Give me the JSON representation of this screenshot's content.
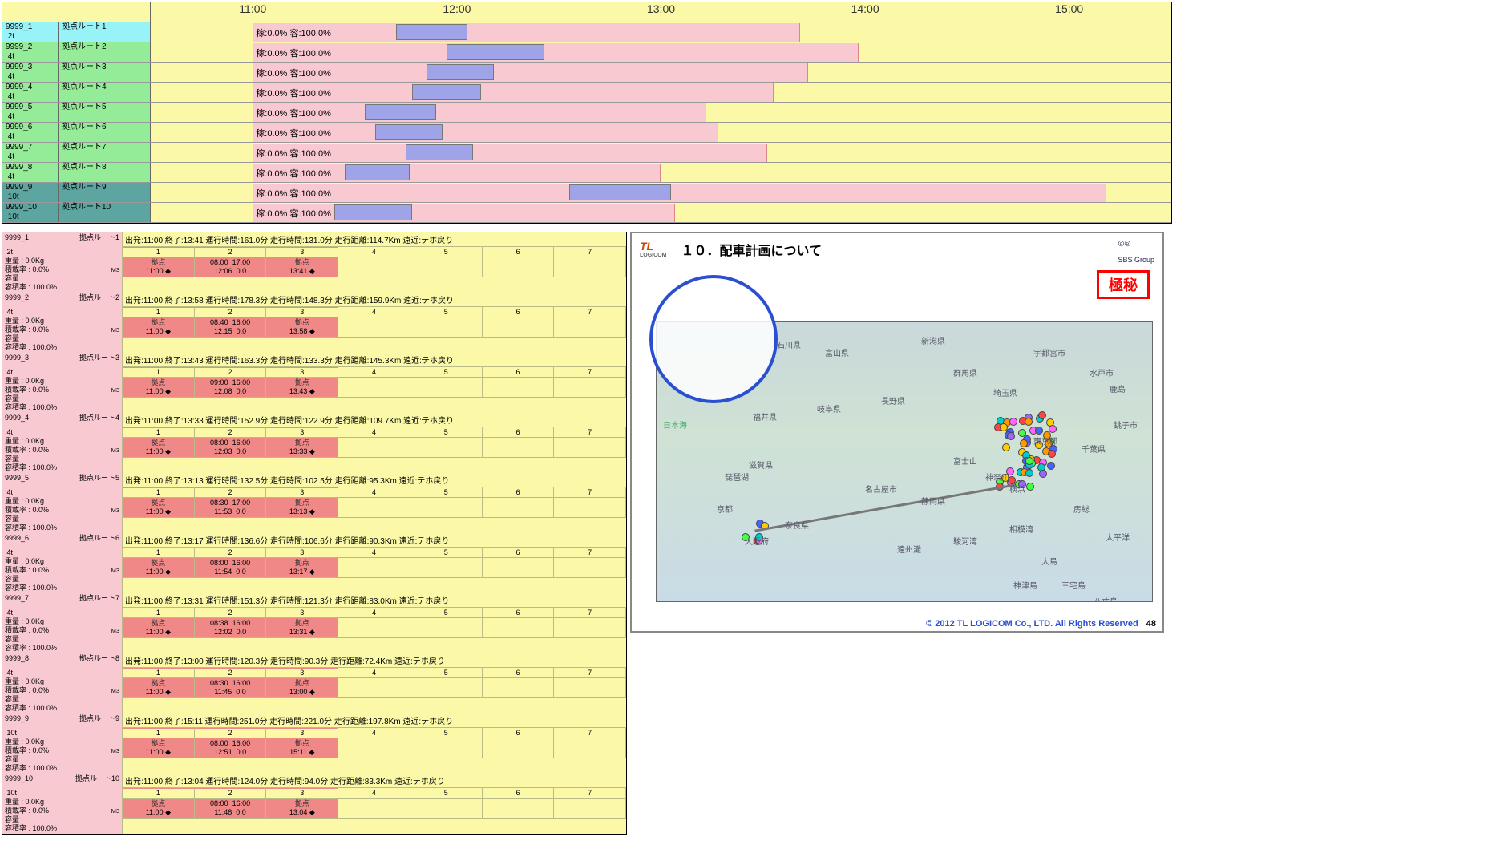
{
  "gantt": {
    "time_start": 10.5,
    "time_end": 15.5,
    "ticks": [
      "11:00",
      "12:00",
      "13:00",
      "14:00",
      "15:00"
    ],
    "label_text": "稼:0.0% 容:100.0%",
    "rows": [
      {
        "id": "9999_1",
        "cap": "2t",
        "route": "拠点ルート1",
        "cls": "lc-cyan",
        "pink_s": 11.0,
        "pink_e": 13.68,
        "blue_s": 11.7,
        "blue_e": 12.05
      },
      {
        "id": "9999_2",
        "cap": "4t",
        "route": "拠点ルート2",
        "cls": "lc-green",
        "pink_s": 11.0,
        "pink_e": 13.97,
        "blue_s": 11.95,
        "blue_e": 12.43
      },
      {
        "id": "9999_3",
        "cap": "4t",
        "route": "拠点ルート3",
        "cls": "lc-green",
        "pink_s": 11.0,
        "pink_e": 13.72,
        "blue_s": 11.85,
        "blue_e": 12.18
      },
      {
        "id": "9999_4",
        "cap": "4t",
        "route": "拠点ルート4",
        "cls": "lc-green",
        "pink_s": 11.0,
        "pink_e": 13.55,
        "blue_s": 11.78,
        "blue_e": 12.12
      },
      {
        "id": "9999_5",
        "cap": "4t",
        "route": "拠点ルート5",
        "cls": "lc-green",
        "pink_s": 11.0,
        "pink_e": 13.22,
        "blue_s": 11.55,
        "blue_e": 11.9
      },
      {
        "id": "9999_6",
        "cap": "4t",
        "route": "拠点ルート6",
        "cls": "lc-green",
        "pink_s": 11.0,
        "pink_e": 13.28,
        "blue_s": 11.6,
        "blue_e": 11.93
      },
      {
        "id": "9999_7",
        "cap": "4t",
        "route": "拠点ルート7",
        "cls": "lc-green",
        "pink_s": 11.0,
        "pink_e": 13.52,
        "blue_s": 11.75,
        "blue_e": 12.08
      },
      {
        "id": "9999_8",
        "cap": "4t",
        "route": "拠点ルート8",
        "cls": "lc-green",
        "pink_s": 11.0,
        "pink_e": 13.0,
        "blue_s": 11.45,
        "blue_e": 11.77
      },
      {
        "id": "9999_9",
        "cap": "10t",
        "route": "拠点ルート9",
        "cls": "lc-teal",
        "pink_s": 11.0,
        "pink_e": 15.18,
        "blue_s": 12.55,
        "blue_e": 13.05
      },
      {
        "id": "9999_10",
        "cap": "10t",
        "route": "拠点ルート10",
        "cls": "lc-teal",
        "pink_s": 11.0,
        "pink_e": 13.07,
        "blue_s": 11.4,
        "blue_e": 11.78
      }
    ]
  },
  "detail": {
    "stat_labels": {
      "weight": "重量 :",
      "loadrate": "積載率 :",
      "vol": "容量",
      "volrate": "容積率 :"
    },
    "stat_vals": {
      "weight": "0.0Kg",
      "loadrate": "0.0%",
      "vol": "M3",
      "volrate": "100.0%"
    },
    "col_count": 7,
    "kyoten": "拠点",
    "routes": [
      {
        "id": "9999_1",
        "cap": "2t",
        "route": "拠点ルート1",
        "summary": "出発:11:00 終了:13:41  運行時間:161.0分  走行時間:131.0分  走行距離:114.7Km  遠近:テホ戻り",
        "cells": [
          {
            "t1": "11:00 ◆"
          },
          {
            "t1": "08:00",
            "t2": "12:06",
            "t3": "17:00",
            "t4": "0.0"
          },
          {
            "t1": "13:41 ◆"
          }
        ]
      },
      {
        "id": "9999_2",
        "cap": "4t",
        "route": "拠点ルート2",
        "summary": "出発:11:00 終了:13:58  運行時間:178.3分  走行時間:148.3分  走行距離:159.9Km  遠近:テホ戻り",
        "cells": [
          {
            "t1": "11:00 ◆"
          },
          {
            "t1": "08:40",
            "t2": "12:15",
            "t3": "16:00",
            "t4": "0.0"
          },
          {
            "t1": "13:58 ◆"
          }
        ]
      },
      {
        "id": "9999_3",
        "cap": "4t",
        "route": "拠点ルート3",
        "summary": "出発:11:00 終了:13:43  運行時間:163.3分  走行時間:133.3分  走行距離:145.3Km  遠近:テホ戻り",
        "cells": [
          {
            "t1": "11:00 ◆"
          },
          {
            "t1": "09:00",
            "t2": "12:08",
            "t3": "16:00",
            "t4": "0.0"
          },
          {
            "t1": "13:43 ◆"
          }
        ]
      },
      {
        "id": "9999_4",
        "cap": "4t",
        "route": "拠点ルート4",
        "summary": "出発:11:00 終了:13:33  運行時間:152.9分  走行時間:122.9分  走行距離:109.7Km  遠近:テホ戻り",
        "cells": [
          {
            "t1": "11:00 ◆"
          },
          {
            "t1": "08:00",
            "t2": "12:03",
            "t3": "16:00",
            "t4": "0.0"
          },
          {
            "t1": "13:33 ◆"
          }
        ]
      },
      {
        "id": "9999_5",
        "cap": "4t",
        "route": "拠点ルート5",
        "summary": "出発:11:00 終了:13:13  運行時間:132.5分  走行時間:102.5分  走行距離:95.3Km  遠近:テホ戻り",
        "cells": [
          {
            "t1": "11:00 ◆"
          },
          {
            "t1": "08:30",
            "t2": "11:53",
            "t3": "17:00",
            "t4": "0.0"
          },
          {
            "t1": "13:13 ◆"
          }
        ]
      },
      {
        "id": "9999_6",
        "cap": "4t",
        "route": "拠点ルート6",
        "summary": "出発:11:00 終了:13:17  運行時間:136.6分  走行時間:106.6分  走行距離:90.3Km  遠近:テホ戻り",
        "cells": [
          {
            "t1": "11:00 ◆"
          },
          {
            "t1": "08:00",
            "t2": "11:54",
            "t3": "16:00",
            "t4": "0.0"
          },
          {
            "t1": "13:17 ◆"
          }
        ]
      },
      {
        "id": "9999_7",
        "cap": "4t",
        "route": "拠点ルート7",
        "summary": "出発:11:00 終了:13:31  運行時間:151.3分  走行時間:121.3分  走行距離:83.0Km  遠近:テホ戻り",
        "cells": [
          {
            "t1": "11:00 ◆"
          },
          {
            "t1": "08:38",
            "t2": "12:02",
            "t3": "16:00",
            "t4": "0.0"
          },
          {
            "t1": "13:31 ◆"
          }
        ]
      },
      {
        "id": "9999_8",
        "cap": "4t",
        "route": "拠点ルート8",
        "summary": "出発:11:00 終了:13:00  運行時間:120.3分  走行時間:90.3分  走行距離:72.4Km  遠近:テホ戻り",
        "cells": [
          {
            "t1": "11:00 ◆"
          },
          {
            "t1": "08:30",
            "t2": "11:45",
            "t3": "16:00",
            "t4": "0.0"
          },
          {
            "t1": "13:00 ◆"
          }
        ]
      },
      {
        "id": "9999_9",
        "cap": "10t",
        "route": "拠点ルート9",
        "summary": "出発:11:00 終了:15:11  運行時間:251.0分  走行時間:221.0分  走行距離:197.8Km  遠近:テホ戻り",
        "cells": [
          {
            "t1": "11:00 ◆"
          },
          {
            "t1": "08:00",
            "t2": "12:51",
            "t3": "16:00",
            "t4": "0.0"
          },
          {
            "t1": "15:11 ◆"
          }
        ]
      },
      {
        "id": "9999_10",
        "cap": "10t",
        "route": "拠点ルート10",
        "summary": "出発:11:00 終了:13:04  運行時間:124.0分  走行時間:94.0分  走行距離:83.3Km  遠近:テホ戻り",
        "cells": [
          {
            "t1": "11:00 ◆"
          },
          {
            "t1": "08:00",
            "t2": "11:48",
            "t3": "16:00",
            "t4": "0.0"
          },
          {
            "t1": "13:04 ◆"
          }
        ]
      }
    ]
  },
  "slide": {
    "logo_main": "TL",
    "logo_sub": "LOGICOM",
    "title": "１０．配車計画について",
    "badge": "極秘",
    "sea_label": "日本海",
    "places": [
      "石川県",
      "富山県",
      "岐阜県",
      "長野県",
      "新潟県",
      "群馬県",
      "埼玉県",
      "宇都宮市",
      "水戸市",
      "東京都",
      "千葉県",
      "福井県",
      "滋賀県",
      "琵琶湖",
      "京都",
      "大阪府",
      "奈良県",
      "名古屋市",
      "静岡県",
      "富士山",
      "横浜",
      "神奈川",
      "遠州灘",
      "駿河湾",
      "相模湾",
      "房総",
      "大島",
      "神津島",
      "三宅島",
      "八丈島",
      "太平洋",
      "鹿島",
      "銚子市"
    ],
    "footer": "© 2012 TL LOGICOM Co., LTD. All  Rights Reserved",
    "page": "48",
    "sbs": "SBS Group"
  }
}
